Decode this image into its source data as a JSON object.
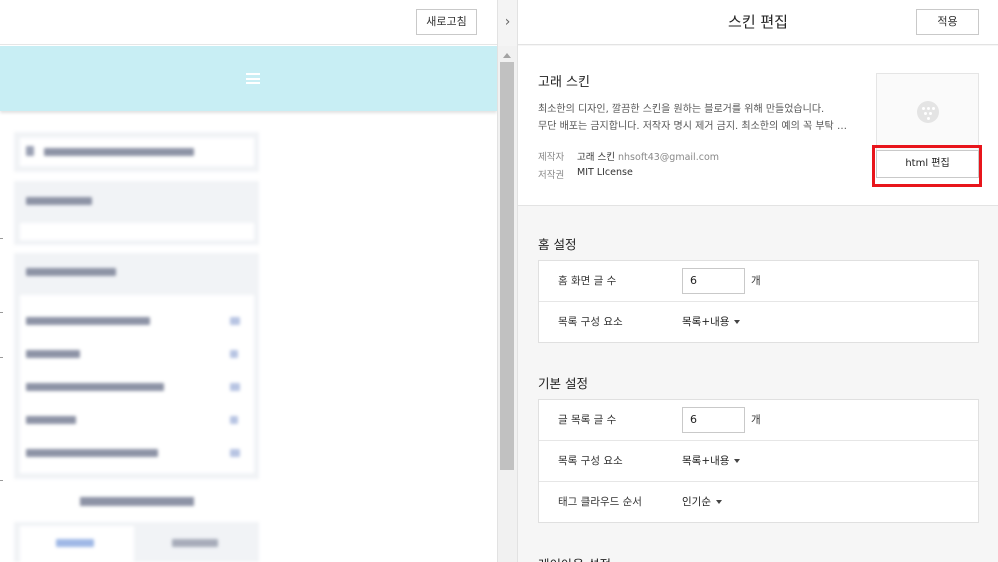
{
  "preview": {
    "refresh_label": "새로고침"
  },
  "divider": {
    "collapse_glyph": "›"
  },
  "panel": {
    "title": "스킨 편집",
    "apply_label": "적용",
    "skin": {
      "name": "고래 스킨",
      "description_lines": [
        "최소한의 디자인, 깔끔한 스킨을 원하는 블로거를 위해 만들었습니다.",
        "무단 배포는 금지합니다. 저작자 명시 제거 금지. 최소한의 예의 꼭 부탁 드립…"
      ],
      "author_label": "제작자",
      "author_name": "고래 스킨",
      "author_email": "nhsoft43@gmail.com",
      "license_label": "저작권",
      "license_value": "MIT LIcense",
      "html_edit_label": "html 편집",
      "highlight_color": "#e8151b"
    },
    "home_settings": {
      "title": "홈 설정",
      "rows": [
        {
          "label": "홈 화면 글 수",
          "value": "6",
          "unit": "개"
        },
        {
          "label": "목록 구성 요소",
          "option": "목록+내용"
        }
      ]
    },
    "basic_settings": {
      "title": "기본 설정",
      "rows": [
        {
          "label": "글 목록 글 수",
          "value": "6",
          "unit": "개"
        },
        {
          "label": "목록 구성 요소",
          "option": "목록+내용"
        },
        {
          "label": "태그 클라우드 순서",
          "option": "인기순"
        }
      ]
    },
    "layout_settings": {
      "title": "레이아웃 설정"
    }
  },
  "colors": {
    "header_bg": "#c8eef4",
    "panel_bg": "#f6f6f6",
    "widget_bg": "#f1f3f6"
  }
}
